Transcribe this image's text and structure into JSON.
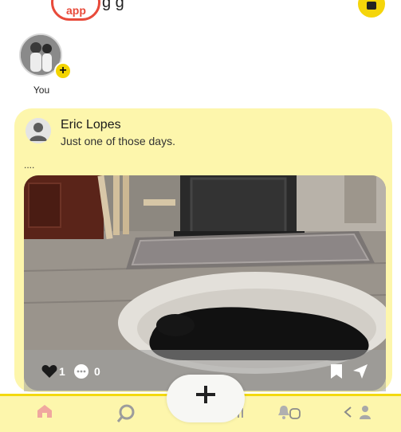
{
  "header": {
    "app_logo_text": "app",
    "title_fragment": "g         g",
    "top_right_icon": "camera-icon"
  },
  "stories": [
    {
      "label": "You",
      "badge": "+"
    }
  ],
  "post": {
    "author": "Eric Lopes",
    "caption": "Just one of those days.",
    "more_indicator": "....",
    "likes": "1",
    "comments": "0",
    "actions": [
      "heart-icon",
      "comment-icon",
      "bookmark-icon",
      "send-icon"
    ]
  },
  "create_button": {
    "symbol": "+"
  },
  "bottom_nav": {
    "items": [
      "home-icon",
      "search-icon",
      "system-menu-icon",
      "notification-icon",
      "system-home-icon",
      "system-back-icon",
      "profile-icon"
    ]
  },
  "colors": {
    "accent_yellow": "#f3d400",
    "card_background": "#fdf6ac",
    "brand_red": "#e84a3a"
  }
}
